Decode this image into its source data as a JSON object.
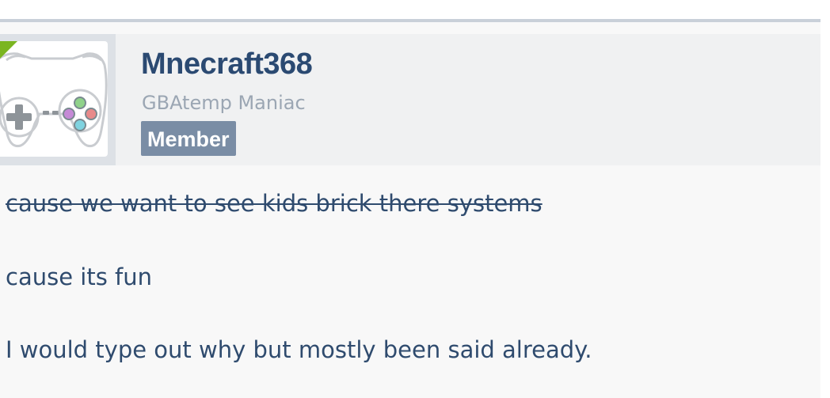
{
  "post": {
    "author": {
      "username": "Mnecraft368",
      "title": "GBAtemp Maniac",
      "badge": "Member",
      "avatar_icon": "gamepad-icon",
      "online_indicator_color": "#7ab520"
    },
    "body": {
      "line1": "cause we want to see kids brick there systems",
      "line2": "cause its fun",
      "line3": "I would type out why but mostly been said already."
    }
  },
  "colors": {
    "username": "#2b4a72",
    "badge_bg": "#7a8da5",
    "body_text": "#2f4b6e"
  }
}
